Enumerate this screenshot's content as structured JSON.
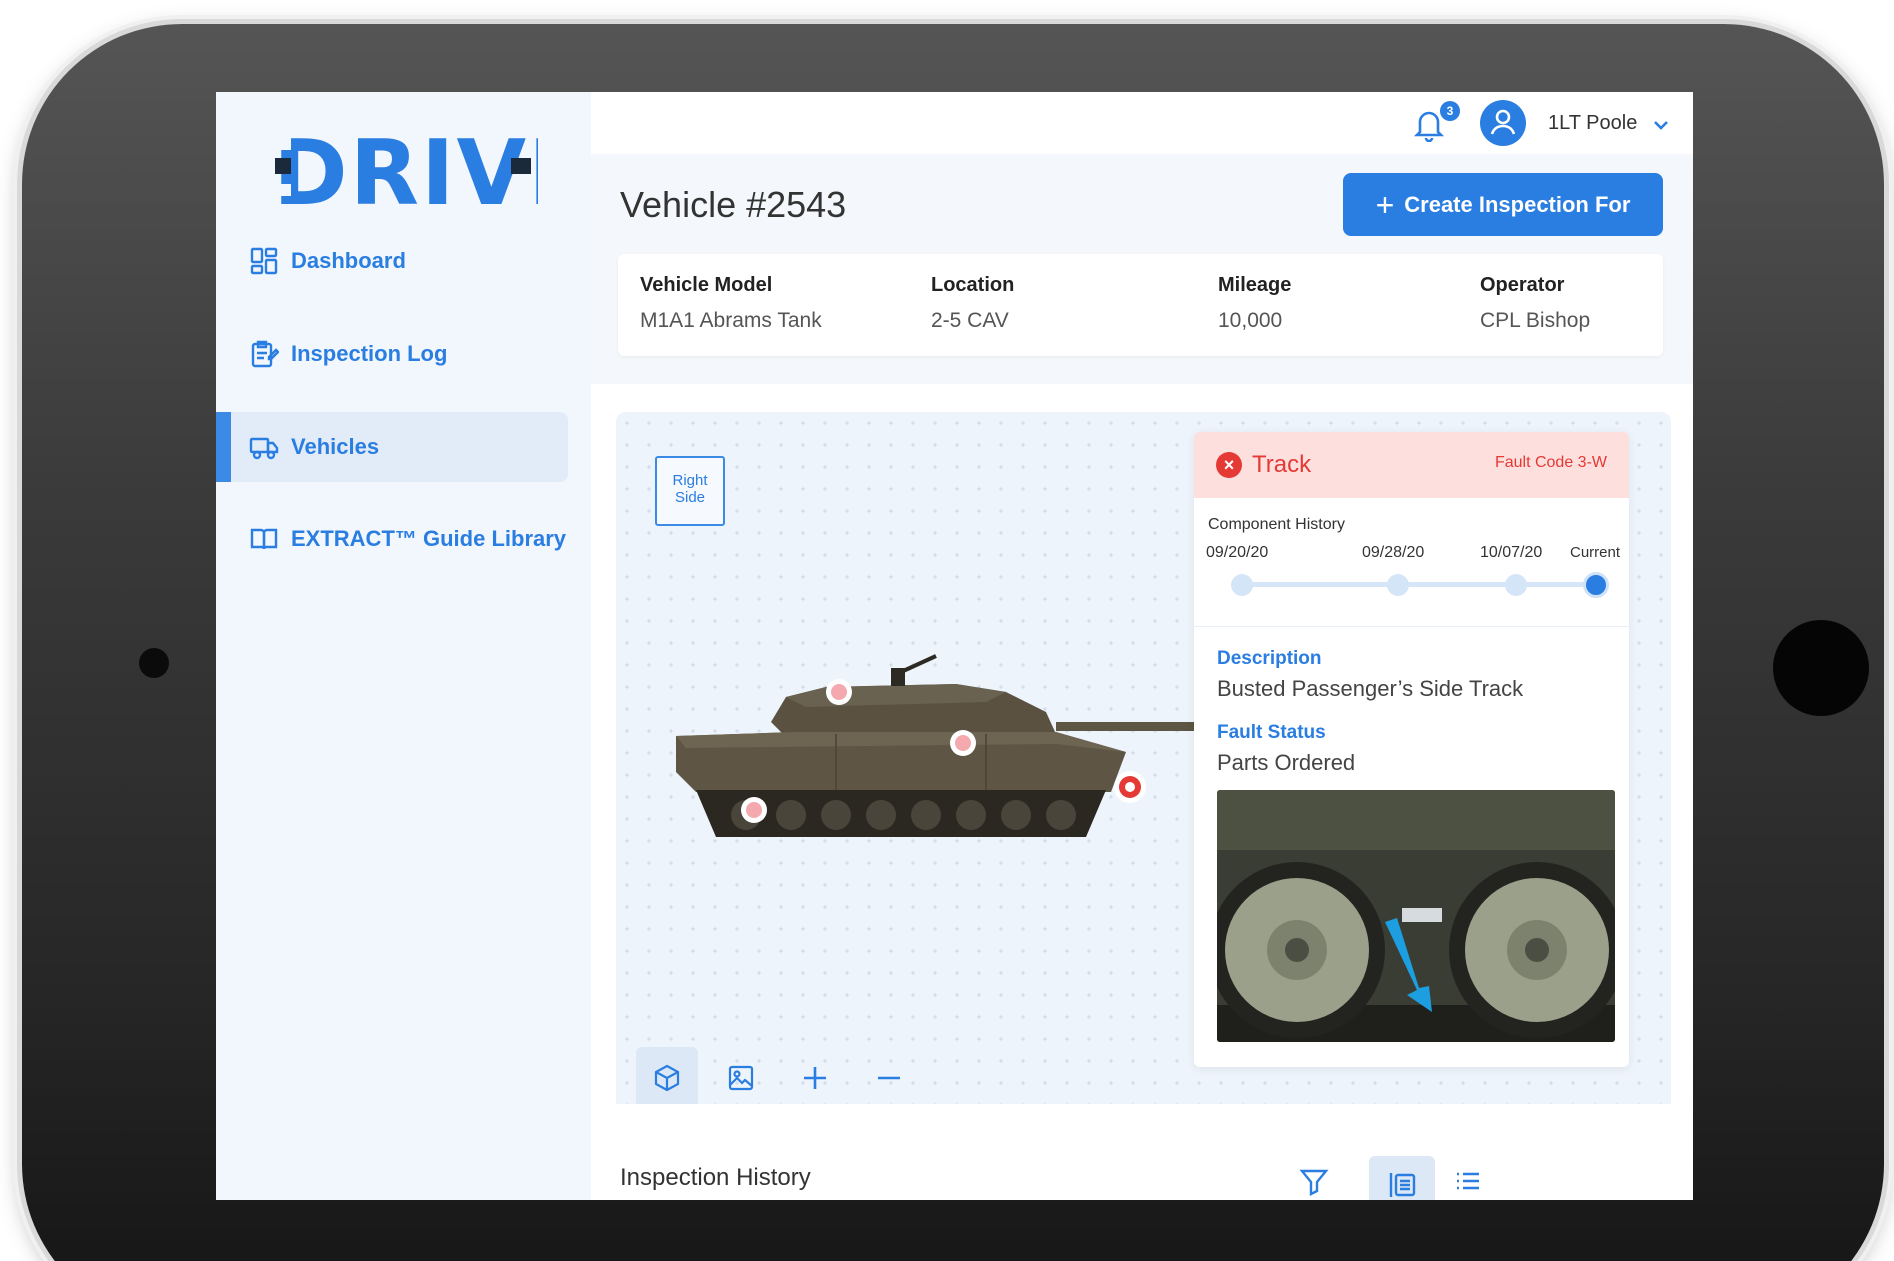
{
  "app": {
    "logo_text": "DRIVE"
  },
  "sidebar": {
    "items": [
      {
        "label": "Dashboard",
        "icon": "dashboard-icon",
        "active": false
      },
      {
        "label": "Inspection Log",
        "icon": "inspection-log-icon",
        "active": false
      },
      {
        "label": "Vehicles",
        "icon": "truck-icon",
        "active": true
      },
      {
        "label": "EXTRACT™ Guide Library",
        "icon": "book-icon",
        "active": false
      }
    ]
  },
  "topbar": {
    "notification_count": "3",
    "user_name": "1LT Poole"
  },
  "header": {
    "title": "Vehicle #2543",
    "create_button": "Create Inspection For"
  },
  "vehicle_info": {
    "model": {
      "label": "Vehicle Model",
      "value": "M1A1 Abrams Tank"
    },
    "location": {
      "label": "Location",
      "value": "2-5 CAV"
    },
    "mileage": {
      "label": "Mileage",
      "value": "10,000"
    },
    "operator": {
      "label": "Operator",
      "value": "CPL Bishop"
    }
  },
  "viewer": {
    "side_label_line1": "Right",
    "side_label_line2": "Side",
    "tools": [
      "cube-icon",
      "image-icon",
      "zoom-in-icon",
      "zoom-out-icon"
    ]
  },
  "fault": {
    "component": "Track",
    "code": "Fault Code 3-W",
    "history_title": "Component History",
    "history_dates": [
      "09/20/20",
      "09/28/20",
      "10/07/20",
      "Current"
    ],
    "description_label": "Description",
    "description": "Busted Passenger’s Side Track",
    "status_label": "Fault Status",
    "status": "Parts Ordered",
    "colors": {
      "fault_red": "#e53935",
      "accent_blue": "#2a7de1"
    }
  },
  "inspection_history": {
    "title": "Inspection History"
  }
}
